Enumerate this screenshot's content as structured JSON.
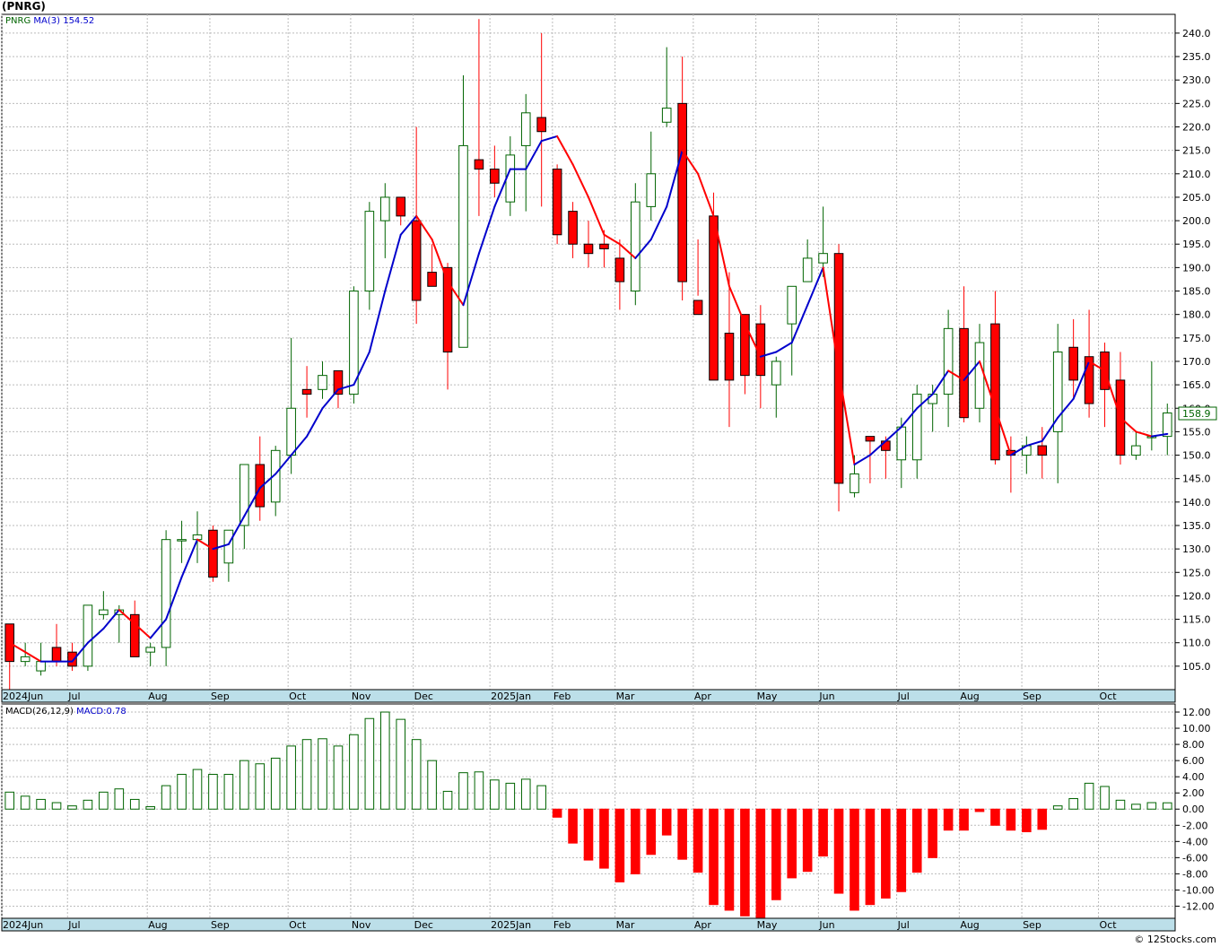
{
  "header": {
    "symbol": "(PNRG)"
  },
  "credit": "© 12Stocks.com",
  "colors": {
    "up": "#006400",
    "down": "#ff0000",
    "ma_up": "#0000cc",
    "ma_down": "#ff0000",
    "axis_band": "#bcdfe9"
  },
  "chart_data": [
    {
      "type": "candlestick",
      "legend": {
        "symbol": "PNRG",
        "ma": "MA(3)",
        "ma_value": "154.52"
      },
      "last_price": "158.9",
      "ylim": [
        100,
        244
      ],
      "yticks": [
        105,
        110,
        115,
        120,
        125,
        130,
        135,
        140,
        145,
        150,
        155,
        160,
        165,
        170,
        175,
        180,
        185,
        190,
        195,
        200,
        205,
        210,
        215,
        220,
        225,
        230,
        235,
        240
      ],
      "x_labels": [
        "2024Jun",
        "Jul",
        "Aug",
        "Sep",
        "Oct",
        "Nov",
        "Dec",
        "2025Jan",
        "Feb",
        "Mar",
        "Apr",
        "May",
        "Jun",
        "Jul",
        "Aug",
        "Sep",
        "Oct"
      ],
      "x_label_index": [
        0,
        4.2,
        9.3,
        13.3,
        18.3,
        22.3,
        26.3,
        31.2,
        35.2,
        39.2,
        44.2,
        48.2,
        52.2,
        57.2,
        61.2,
        65.2,
        70.1
      ],
      "ohlc": [
        [
          114,
          111,
          100,
          106
        ],
        [
          106,
          110,
          105,
          107
        ],
        [
          104,
          110,
          103,
          106
        ],
        [
          109,
          114,
          105,
          106
        ],
        [
          108,
          110,
          104,
          105
        ],
        [
          105,
          118,
          104,
          118
        ],
        [
          116,
          121,
          115,
          117
        ],
        [
          116,
          118,
          110,
          117
        ],
        [
          116,
          119,
          107,
          107
        ],
        [
          108,
          110,
          105,
          109
        ],
        [
          109,
          134,
          105,
          132
        ],
        [
          132,
          136,
          127,
          132
        ],
        [
          132,
          138,
          127,
          133
        ],
        [
          134,
          135,
          123,
          124
        ],
        [
          127,
          134,
          123,
          134
        ],
        [
          135,
          144,
          130,
          148
        ],
        [
          148,
          154,
          136,
          139
        ],
        [
          140,
          152,
          137,
          151
        ],
        [
          150,
          175,
          146,
          160
        ],
        [
          164,
          169,
          158,
          163
        ],
        [
          164,
          170,
          162,
          167
        ],
        [
          168,
          168,
          160,
          163
        ],
        [
          163,
          186,
          161,
          185
        ],
        [
          185,
          204,
          181,
          202
        ],
        [
          200,
          208,
          192,
          205
        ],
        [
          205,
          204,
          199,
          201
        ],
        [
          200,
          220,
          178,
          183
        ],
        [
          189,
          195,
          186,
          186
        ],
        [
          190,
          191,
          164,
          172
        ],
        [
          173,
          231,
          173,
          216
        ],
        [
          213,
          243,
          201,
          211
        ],
        [
          211,
          216,
          205,
          208
        ],
        [
          204,
          218,
          201,
          214
        ],
        [
          216,
          227,
          202,
          223
        ],
        [
          222,
          240,
          203,
          219
        ],
        [
          211,
          212,
          195,
          197
        ],
        [
          202,
          204,
          192,
          195
        ],
        [
          195,
          200,
          190,
          193
        ],
        [
          195,
          198,
          190,
          194
        ],
        [
          192,
          196,
          181,
          187
        ],
        [
          185,
          208,
          182,
          204
        ],
        [
          203,
          219,
          200,
          210
        ],
        [
          221,
          237,
          220,
          224
        ],
        [
          225,
          235,
          183,
          187
        ],
        [
          183,
          196,
          184,
          180
        ],
        [
          201,
          206,
          178,
          166
        ],
        [
          176,
          189,
          156,
          166
        ],
        [
          180,
          180,
          163,
          167
        ],
        [
          178,
          182,
          160,
          167
        ],
        [
          165,
          171,
          158,
          170
        ],
        [
          178,
          186,
          167,
          186
        ],
        [
          187,
          196,
          187,
          192
        ],
        [
          191,
          203,
          188,
          193
        ],
        [
          193,
          195,
          138,
          144
        ],
        [
          142,
          150,
          141,
          146
        ],
        [
          154,
          154,
          144,
          153
        ],
        [
          153,
          154,
          145,
          151
        ],
        [
          149,
          158,
          143,
          156
        ],
        [
          149,
          165,
          145,
          163
        ],
        [
          161,
          165,
          155,
          163
        ],
        [
          163,
          181,
          156,
          177
        ],
        [
          177,
          186,
          157,
          158
        ],
        [
          160,
          178,
          157,
          174
        ],
        [
          178,
          185,
          148,
          149
        ],
        [
          151,
          154,
          142,
          150
        ],
        [
          150,
          154,
          146,
          152
        ],
        [
          152,
          156,
          145,
          150
        ],
        [
          155,
          178,
          144,
          172
        ],
        [
          173,
          179,
          162,
          166
        ],
        [
          171,
          181,
          158,
          161
        ],
        [
          172,
          174,
          156,
          164
        ],
        [
          166,
          172,
          148,
          150
        ],
        [
          150,
          155,
          149,
          152
        ],
        [
          154,
          170,
          151,
          154
        ],
        [
          154,
          161,
          150,
          159
        ]
      ],
      "ma3": [
        110,
        108,
        106,
        106,
        106,
        110,
        113,
        117,
        114,
        111,
        115,
        124,
        132,
        130,
        131,
        137,
        143,
        146,
        150,
        154,
        160,
        164,
        165,
        172,
        185,
        197,
        201,
        196,
        187,
        182,
        193,
        203,
        211,
        211,
        217,
        218,
        212,
        205,
        197,
        195,
        192,
        196,
        203,
        215,
        210,
        201,
        186,
        178,
        171,
        172,
        174,
        182,
        190,
        168,
        148,
        150,
        153,
        156,
        160,
        163,
        168,
        166,
        170,
        160,
        150,
        152,
        153,
        158,
        162,
        170,
        168,
        158,
        155,
        154,
        154.52
      ]
    },
    {
      "type": "bar",
      "legend": {
        "name": "MACD(26,12,9)",
        "value_label": "MACD:0.78"
      },
      "ylim": [
        -13.5,
        13
      ],
      "yticks": [
        -12,
        -10,
        -8,
        -6,
        -4,
        -2,
        0,
        2,
        4,
        6,
        8,
        10,
        12
      ],
      "ytick_labels": [
        "-12.00",
        "-10.00",
        "-8.00",
        "-6.00",
        "-4.00",
        "-2.00",
        "0.00",
        "2.00",
        "4.00",
        "6.00",
        "8.00",
        "10.00",
        "12.00"
      ],
      "x_labels": [
        "2024Jun",
        "Jul",
        "Aug",
        "Sep",
        "Oct",
        "Nov",
        "Dec",
        "2025Jan",
        "Feb",
        "Mar",
        "Apr",
        "May",
        "Jun",
        "Jul",
        "Aug",
        "Sep",
        "Oct"
      ],
      "values": [
        2.1,
        1.6,
        1.2,
        0.8,
        0.4,
        1.1,
        2.1,
        2.5,
        1.2,
        0.3,
        2.9,
        4.3,
        4.9,
        4.3,
        4.3,
        6.0,
        5.6,
        6.3,
        7.8,
        8.6,
        8.7,
        7.8,
        9.2,
        11.2,
        12.0,
        11.1,
        8.6,
        6.0,
        2.2,
        4.5,
        4.6,
        3.6,
        3.2,
        3.7,
        2.9,
        -1.0,
        -4.2,
        -6.3,
        -7.3,
        -9.0,
        -8.0,
        -5.6,
        -3.2,
        -6.2,
        -7.8,
        -11.8,
        -12.5,
        -13.2,
        -14.0,
        -11.2,
        -8.5,
        -7.7,
        -5.8,
        -10.4,
        -12.5,
        -11.8,
        -11.0,
        -10.2,
        -7.8,
        -6.0,
        -2.6,
        -2.6,
        -0.3,
        -2.0,
        -2.6,
        -2.8,
        -2.5,
        0.4,
        1.3,
        3.2,
        2.8,
        1.1,
        0.6,
        0.8,
        0.78
      ]
    }
  ]
}
